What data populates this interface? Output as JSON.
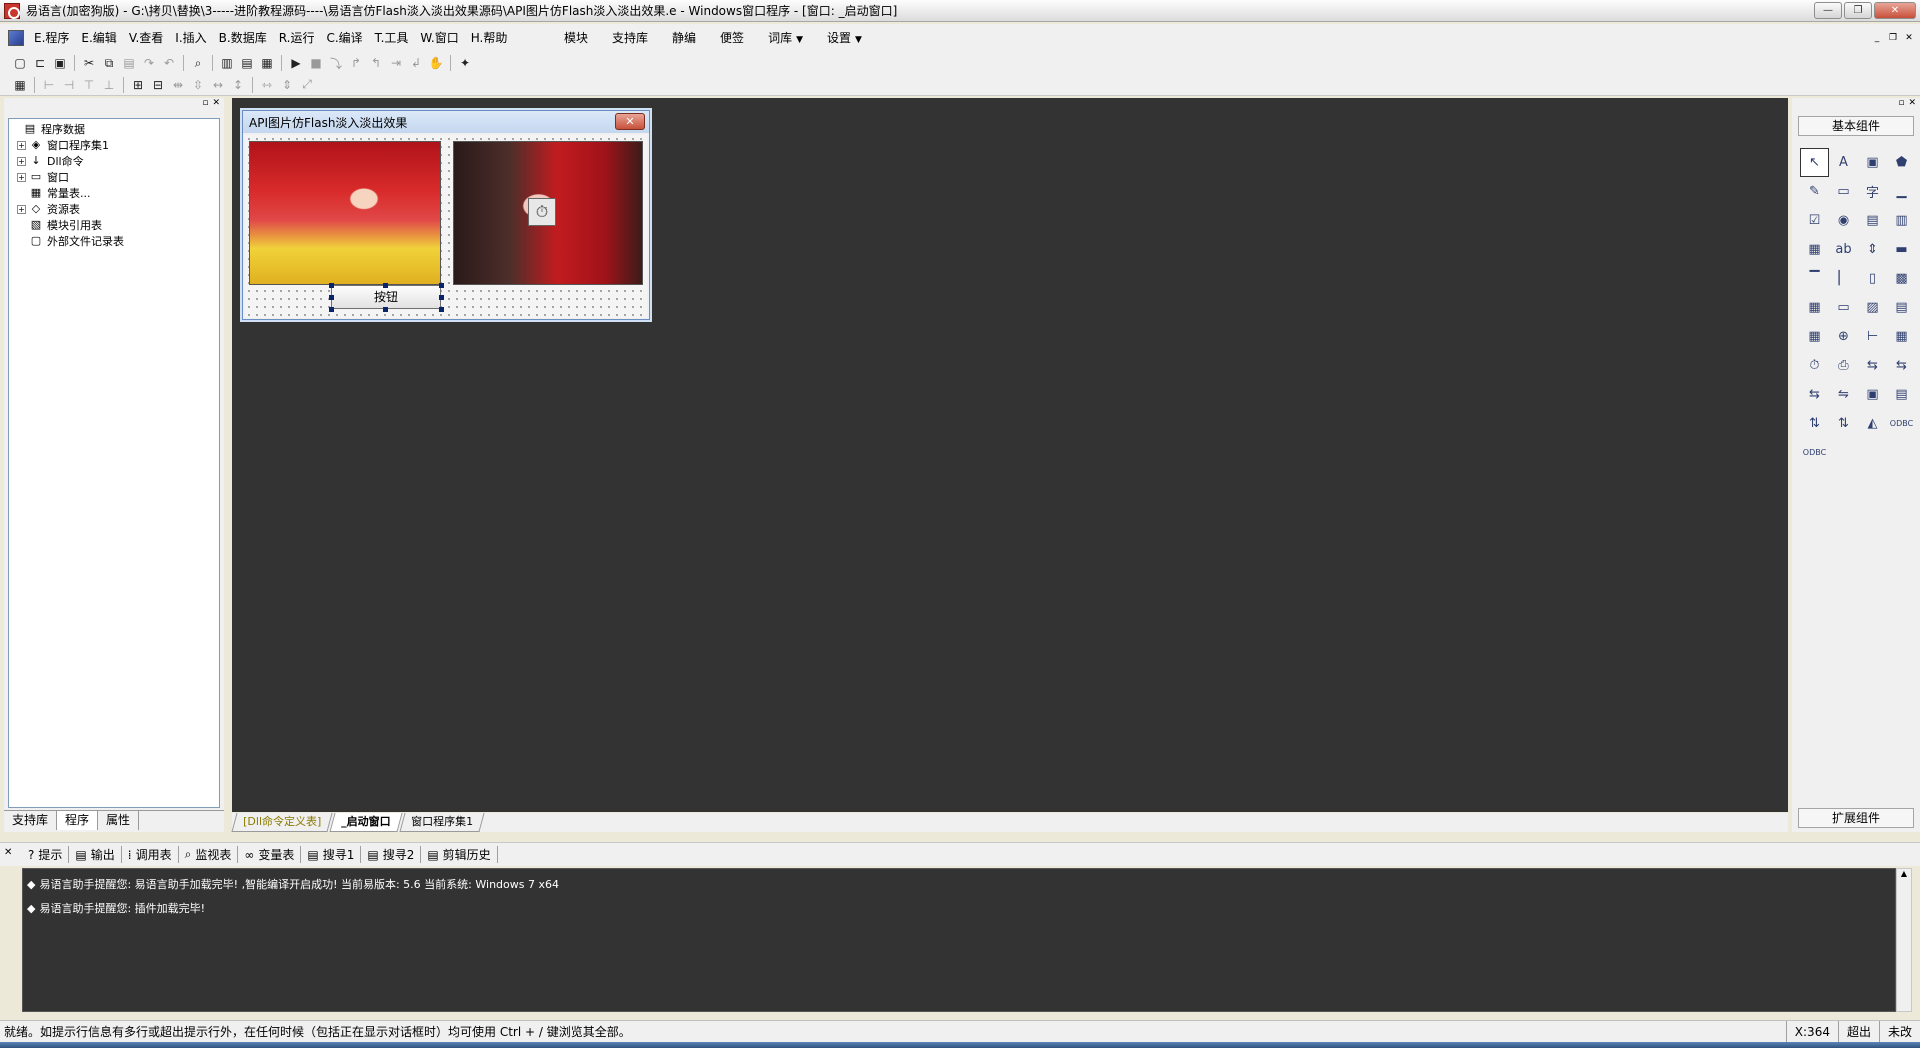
{
  "window": {
    "title": "易语言(加密狗版) - G:\\拷贝\\替换\\3-----进阶教程源码----\\易语言仿Flash淡入淡出效果源码\\API图片仿Flash淡入淡出效果.e - Windows窗口程序 - [窗口: _启动窗口]",
    "min": "—",
    "max": "❐",
    "close": "✕"
  },
  "menu": {
    "items": [
      "E.程序",
      "E.编辑",
      "V.查看",
      "I.插入",
      "B.数据库",
      "R.运行",
      "C.编译",
      "T.工具",
      "W.窗口",
      "H.帮助"
    ],
    "right": [
      "模块",
      "支持库",
      "静编",
      "便签",
      "词库",
      "设置"
    ],
    "mdi": [
      "_",
      "❐",
      "✕"
    ]
  },
  "left_panel": {
    "tree": [
      {
        "label": "程序数据",
        "level": "root",
        "icon": "folder-icon",
        "glyph": "▤"
      },
      {
        "label": "窗口程序集1",
        "level": "child",
        "icon": "module-icon",
        "glyph": "◈"
      },
      {
        "label": "Dll命令",
        "level": "child",
        "icon": "dll-icon",
        "glyph": "↓"
      },
      {
        "label": "窗口",
        "level": "child",
        "icon": "window-icon",
        "glyph": "▭"
      },
      {
        "label": "常量表...",
        "level": "leaf",
        "icon": "constant-icon",
        "glyph": "▦"
      },
      {
        "label": "资源表",
        "level": "child",
        "icon": "resource-icon",
        "glyph": "◇"
      },
      {
        "label": "模块引用表",
        "level": "leaf",
        "icon": "reference-icon",
        "glyph": "▧"
      },
      {
        "label": "外部文件记录表",
        "level": "leaf",
        "icon": "file-icon",
        "glyph": "▢"
      }
    ],
    "tabs": [
      "支持库",
      "程序",
      "属性"
    ]
  },
  "designer": {
    "form_title": "API图片仿Flash淡入淡出效果",
    "form_close": "✕",
    "button_label": "按钮",
    "timer_glyph": "⏱",
    "tabs": [
      "[Dll命令定义表]",
      "_启动窗口",
      "窗口程序集1"
    ]
  },
  "right_panel": {
    "title": "基本组件",
    "bottom": "扩展组件",
    "components": [
      "↖",
      "A",
      "▣",
      "⬟",
      "✎",
      "▭",
      "字",
      "▁",
      "☑",
      "◉",
      "▤",
      "▥",
      "▦",
      "ab",
      "⇕",
      "▬",
      "▔",
      "▏",
      "▯",
      "▩",
      "▦",
      "▭",
      "▨",
      "▤",
      "▦",
      "⊕",
      "⊢",
      "▦",
      "⏱",
      "⎙",
      "⇆",
      "⇆",
      "⇆",
      "⇋",
      "▣",
      "▤",
      "⇅",
      "⇅",
      "◭",
      "ODBC",
      "ODBC"
    ]
  },
  "output": {
    "tabs": [
      {
        "icon": "hint-icon",
        "glyph": "?",
        "label": "提示"
      },
      {
        "icon": "output-icon",
        "glyph": "▤",
        "label": "输出"
      },
      {
        "icon": "calltable-icon",
        "glyph": "⁞",
        "label": "调用表"
      },
      {
        "icon": "watch-icon",
        "glyph": "⌕",
        "label": "监视表"
      },
      {
        "icon": "variable-icon",
        "glyph": "∞",
        "label": "变量表"
      },
      {
        "icon": "search1-icon",
        "glyph": "▤",
        "label": "搜寻1"
      },
      {
        "icon": "search2-icon",
        "glyph": "▤",
        "label": "搜寻2"
      },
      {
        "icon": "clipboard-icon",
        "glyph": "▤",
        "label": "剪辑历史"
      }
    ],
    "lines": [
      "易语言助手提醒您: 易语言助手加载完毕!  ,智能编译开启成功!  当前易版本: 5.6  当前系统: Windows 7 x64",
      "易语言助手提醒您: 插件加载完毕!"
    ]
  },
  "status": {
    "text": "就绪。如提示行信息有多行或超出提示行外，在任何时候（包括正在显示对话框时）均可使用 Ctrl + / 键浏览其全部。",
    "coord": "X:364",
    "mode": "超出",
    "state": "未改"
  }
}
